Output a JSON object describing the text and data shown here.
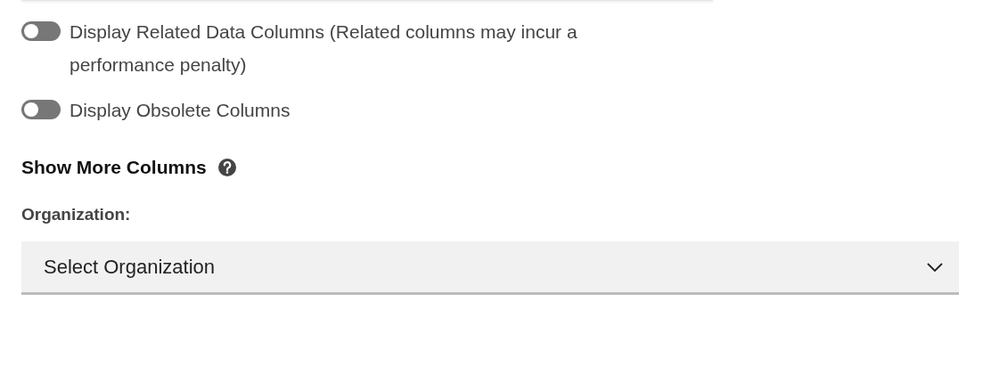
{
  "toggles": [
    {
      "label": "Display Related Data Columns (Related columns may incur a performance penalty)",
      "on": false
    },
    {
      "label": "Display Obsolete Columns",
      "on": false
    }
  ],
  "section": {
    "title": "Show More Columns"
  },
  "organization": {
    "label": "Organization:",
    "placeholder": "Select Organization"
  }
}
